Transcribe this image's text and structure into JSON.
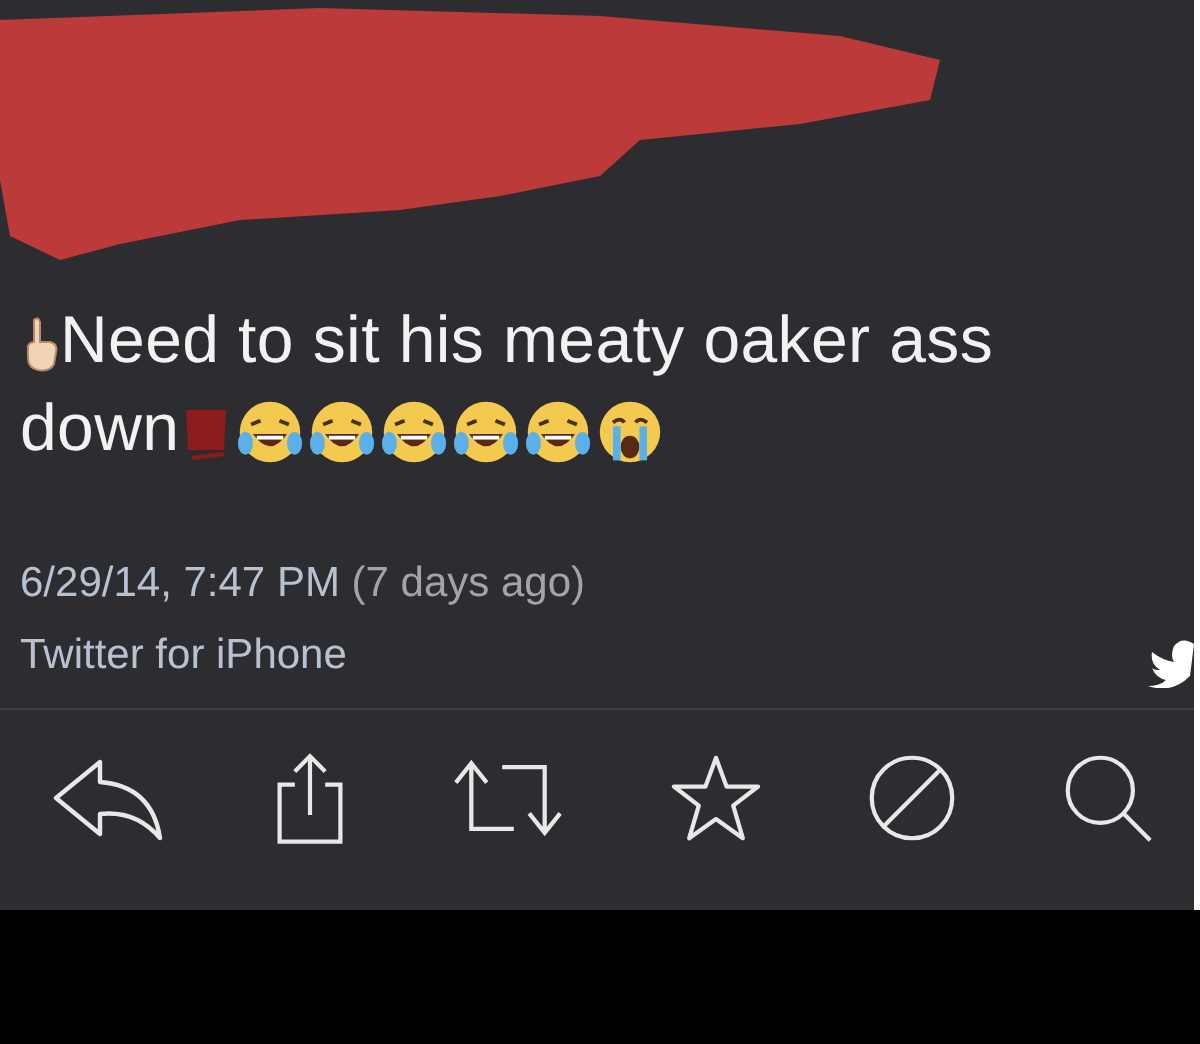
{
  "tweet": {
    "text_lines": [
      "Need to sit his meaty oaker ass",
      "down"
    ],
    "timestamp": "6/29/14, 7:47 PM",
    "relative_time": "(7 days ago)",
    "source": "Twitter for iPhone"
  }
}
